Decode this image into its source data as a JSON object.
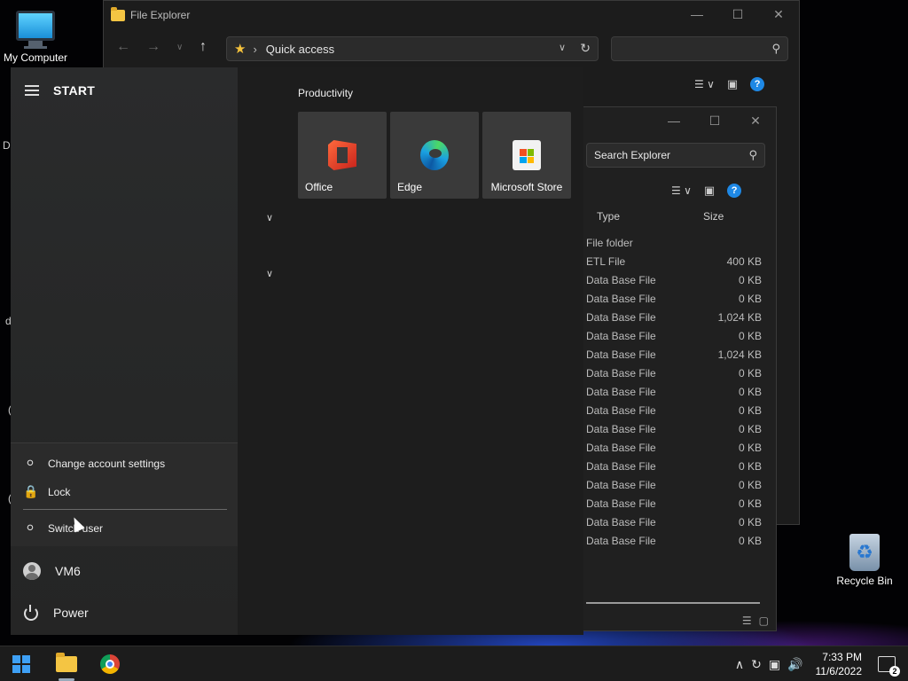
{
  "desktop": {
    "icons": [
      {
        "label": "My Computer"
      },
      {
        "label": "Recycle Bin"
      }
    ],
    "edge_letters": [
      "D",
      "d",
      "(",
      "("
    ]
  },
  "explorer_back": {
    "title": "File Explorer",
    "address": "Quick access",
    "search_value": ""
  },
  "explorer_front": {
    "search_placeholder": "Search Explorer",
    "columns": [
      "Type",
      "Size"
    ],
    "rows": [
      {
        "type": "File folder",
        "size": ""
      },
      {
        "type": "ETL File",
        "size": "400 KB"
      },
      {
        "type": "Data Base File",
        "size": "0 KB"
      },
      {
        "type": "Data Base File",
        "size": "0 KB"
      },
      {
        "type": "Data Base File",
        "size": "1,024 KB"
      },
      {
        "type": "Data Base File",
        "size": "0 KB"
      },
      {
        "type": "Data Base File",
        "size": "1,024 KB"
      },
      {
        "type": "Data Base File",
        "size": "0 KB"
      },
      {
        "type": "Data Base File",
        "size": "0 KB"
      },
      {
        "type": "Data Base File",
        "size": "0 KB"
      },
      {
        "type": "Data Base File",
        "size": "0 KB"
      },
      {
        "type": "Data Base File",
        "size": "0 KB"
      },
      {
        "type": "Data Base File",
        "size": "0 KB"
      },
      {
        "type": "Data Base File",
        "size": "0 KB"
      },
      {
        "type": "Data Base File",
        "size": "0 KB"
      },
      {
        "type": "Data Base File",
        "size": "0 KB"
      },
      {
        "type": "Data Base File",
        "size": "0 KB"
      }
    ]
  },
  "start_menu": {
    "title": "START",
    "group_label": "Productivity",
    "tiles": [
      {
        "label": "Office",
        "icon": "office-icon"
      },
      {
        "label": "Edge",
        "icon": "edge-icon"
      },
      {
        "label": "Microsoft Store",
        "icon": "store-icon"
      }
    ],
    "account_menu": {
      "change_settings": "Change account settings",
      "lock": "Lock",
      "switch_user": "Switch user"
    },
    "user": "VM6",
    "power": "Power"
  },
  "taskbar": {
    "time": "7:33 PM",
    "date": "11/6/2022",
    "notification_count": "2"
  },
  "colors": {
    "accent": "#1e88e5",
    "folder": "#f4c543",
    "start_left_bg": "#2a2b2c",
    "start_right_bg": "#1d1d1d"
  }
}
